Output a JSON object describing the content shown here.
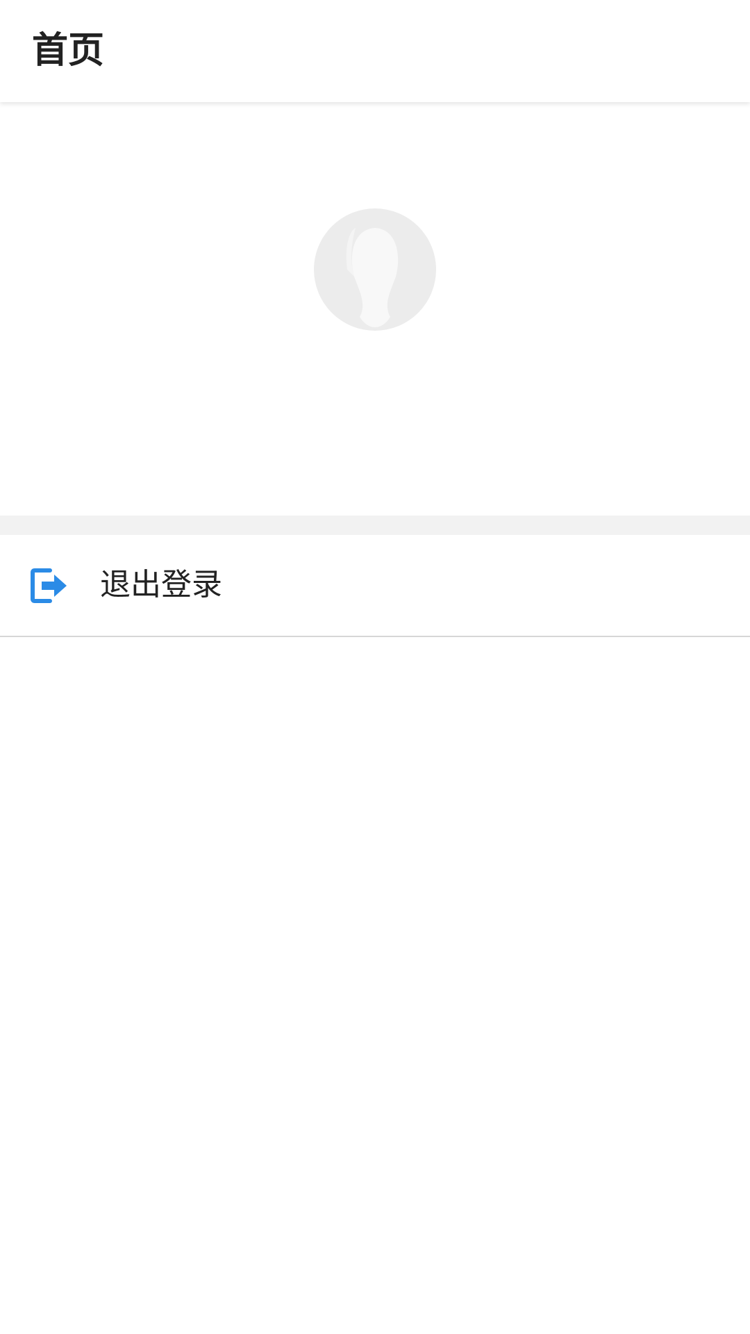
{
  "app_bar": {
    "title": "首页"
  },
  "profile": {
    "avatar_icon": "default-user-avatar-icon"
  },
  "menu": {
    "items": [
      {
        "label": "退出登录",
        "icon": "logout-icon",
        "icon_color": "#2b8be6"
      }
    ]
  },
  "colors": {
    "background": "#ffffff",
    "section_gap": "#f2f2f2",
    "divider": "#d6d6d6",
    "text": "#222222",
    "accent": "#2b8be6",
    "avatar_placeholder": "#ececec"
  }
}
